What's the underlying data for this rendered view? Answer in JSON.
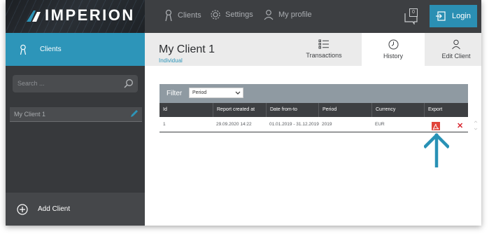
{
  "header": {
    "brand": "IMPERION",
    "nav": [
      {
        "label": "Clients",
        "icon": "ribbon-icon"
      },
      {
        "label": "Settings",
        "icon": "gear-icon"
      },
      {
        "label": "My profile",
        "icon": "user-icon"
      }
    ],
    "notification_count": "0",
    "login_label": "Login"
  },
  "sidebar": {
    "clients_label": "Clients",
    "search_placeholder": "Search ...",
    "clients": [
      {
        "name": "My Client 1"
      }
    ],
    "add_client_label": "Add Client"
  },
  "main": {
    "title": "My Client 1",
    "subtitle": "Individual",
    "tabs": [
      {
        "label": "Transactions",
        "icon": "list-icon"
      },
      {
        "label": "History",
        "icon": "clock-icon",
        "active": true
      },
      {
        "label": "Edit Client",
        "icon": "user-icon"
      }
    ],
    "filter": {
      "label": "Filter",
      "selected": "Period"
    },
    "table": {
      "columns": [
        "Id",
        "Report created at",
        "Date from-to",
        "Period",
        "Currency",
        "Export"
      ],
      "rows": [
        {
          "id": "1",
          "created": "29.09.2020 14:22",
          "range": "01.01.2019 - 31.12.2019",
          "period": "2019",
          "currency": "EUR"
        }
      ]
    }
  },
  "colors": {
    "accent": "#2d95b9",
    "login": "#2b8fb3",
    "topbar": "#3d3f42",
    "sidebar": "#37393c",
    "pdf": "#e0443a",
    "delete": "#d8262f"
  }
}
